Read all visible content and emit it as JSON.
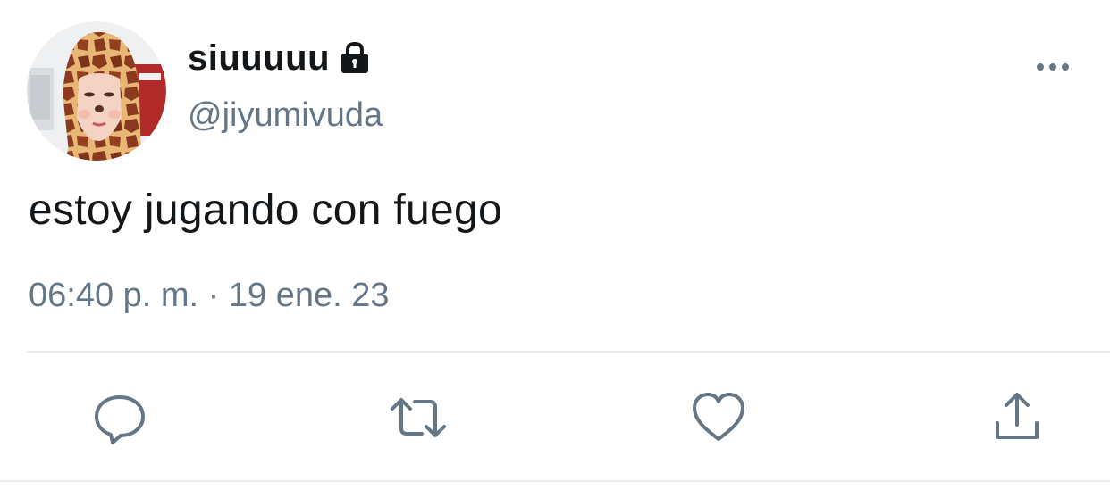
{
  "user": {
    "display_name": "siuuuuu",
    "handle": "@jiyumivuda",
    "protected_icon": "lock-icon",
    "avatar": "profile-photo"
  },
  "tweet": {
    "text": "estoy jugando con fuego",
    "timestamp": "06:40 p. m. · 19 ene. 23"
  },
  "actions": [
    {
      "name": "reply",
      "icon": "reply-icon"
    },
    {
      "name": "retweet",
      "icon": "retweet-icon"
    },
    {
      "name": "like",
      "icon": "heart-icon"
    },
    {
      "name": "share",
      "icon": "share-icon"
    }
  ],
  "menu": {
    "icon": "more-options-icon"
  },
  "colors": {
    "text_primary": "#14171a",
    "text_secondary": "#657786",
    "icon": "#657786",
    "divider": "#e6ecf0"
  }
}
